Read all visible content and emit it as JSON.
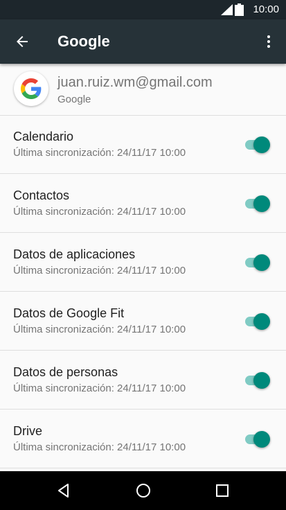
{
  "status_bar": {
    "time": "10:00"
  },
  "app_bar": {
    "title": "Google",
    "back_icon": "arrow-back-icon",
    "more_icon": "more-vert-icon"
  },
  "account": {
    "email": "juan.ruiz.wm@gmail.com",
    "type": "Google",
    "logo_icon": "google-logo-icon"
  },
  "sync_items": [
    {
      "name": "Calendario",
      "last_sync": "Última sincronización: 24/11/17 10:00",
      "enabled": true
    },
    {
      "name": "Contactos",
      "last_sync": "Última sincronización: 24/11/17 10:00",
      "enabled": true
    },
    {
      "name": "Datos de aplicaciones",
      "last_sync": "Última sincronización: 24/11/17 10:00",
      "enabled": true
    },
    {
      "name": "Datos de Google Fit",
      "last_sync": "Última sincronización: 24/11/17 10:00",
      "enabled": true
    },
    {
      "name": "Datos de personas",
      "last_sync": "Última sincronización: 24/11/17 10:00",
      "enabled": true
    },
    {
      "name": "Drive",
      "last_sync": "Última sincronización: 24/11/17 10:00",
      "enabled": true
    }
  ],
  "colors": {
    "app_bar": "#263238",
    "status_bar": "#1d262c",
    "toggle_on_thumb": "#00897b",
    "toggle_on_track": "#80cbc4"
  },
  "nav_bar": {
    "back_icon": "nav-back-icon",
    "home_icon": "nav-home-icon",
    "recents_icon": "nav-recents-icon"
  }
}
